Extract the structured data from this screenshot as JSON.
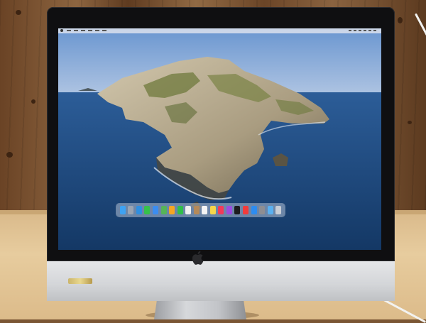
{
  "scene": {
    "description_tags": [
      "imac-desktop-computer",
      "wood-paneled-wall",
      "wooden-desk"
    ],
    "colors": {
      "wall": "#7a5634",
      "desk": "#e0c08f",
      "bezel": "#0f0f11",
      "chin": "#d6d8db",
      "ocean": "#1e4d86",
      "sky": "#87aee0",
      "island_rock": "#b8ad93",
      "island_green": "#6f7a3c"
    }
  },
  "screen": {
    "wallpaper": "island-ocean-wallpaper",
    "menubar": {
      "apple_icon": "apple-icon"
    },
    "dock": {
      "icons": [
        {
          "name": "finder-icon",
          "color": "#3ea2f2"
        },
        {
          "name": "launchpad-icon",
          "color": "#9aa4b2"
        },
        {
          "name": "safari-icon",
          "color": "#2f8fe0"
        },
        {
          "name": "messages-icon",
          "color": "#36c24a"
        },
        {
          "name": "mail-icon",
          "color": "#3b8df0"
        },
        {
          "name": "maps-icon",
          "color": "#55b557"
        },
        {
          "name": "photos-icon",
          "color": "#f5a623"
        },
        {
          "name": "facetime-icon",
          "color": "#2fbf4a"
        },
        {
          "name": "calendar-icon",
          "color": "#f0f0f0"
        },
        {
          "name": "contacts-icon",
          "color": "#b58a5a"
        },
        {
          "name": "reminders-icon",
          "color": "#f4f4f4"
        },
        {
          "name": "notes-icon",
          "color": "#f6d64a"
        },
        {
          "name": "music-icon",
          "color": "#f23a5a"
        },
        {
          "name": "podcasts-icon",
          "color": "#9b4de0"
        },
        {
          "name": "tv-icon",
          "color": "#1c1c1e"
        },
        {
          "name": "news-icon",
          "color": "#f23b3b"
        },
        {
          "name": "app-store-icon",
          "color": "#2d8cf0"
        },
        {
          "name": "system-preferences-icon",
          "color": "#8e8e93"
        },
        {
          "name": "downloads-folder-icon",
          "color": "#5ab0f0"
        },
        {
          "name": "trash-icon",
          "color": "#c9ced6"
        }
      ]
    }
  },
  "chin": {
    "logo": "apple-logo-icon"
  }
}
